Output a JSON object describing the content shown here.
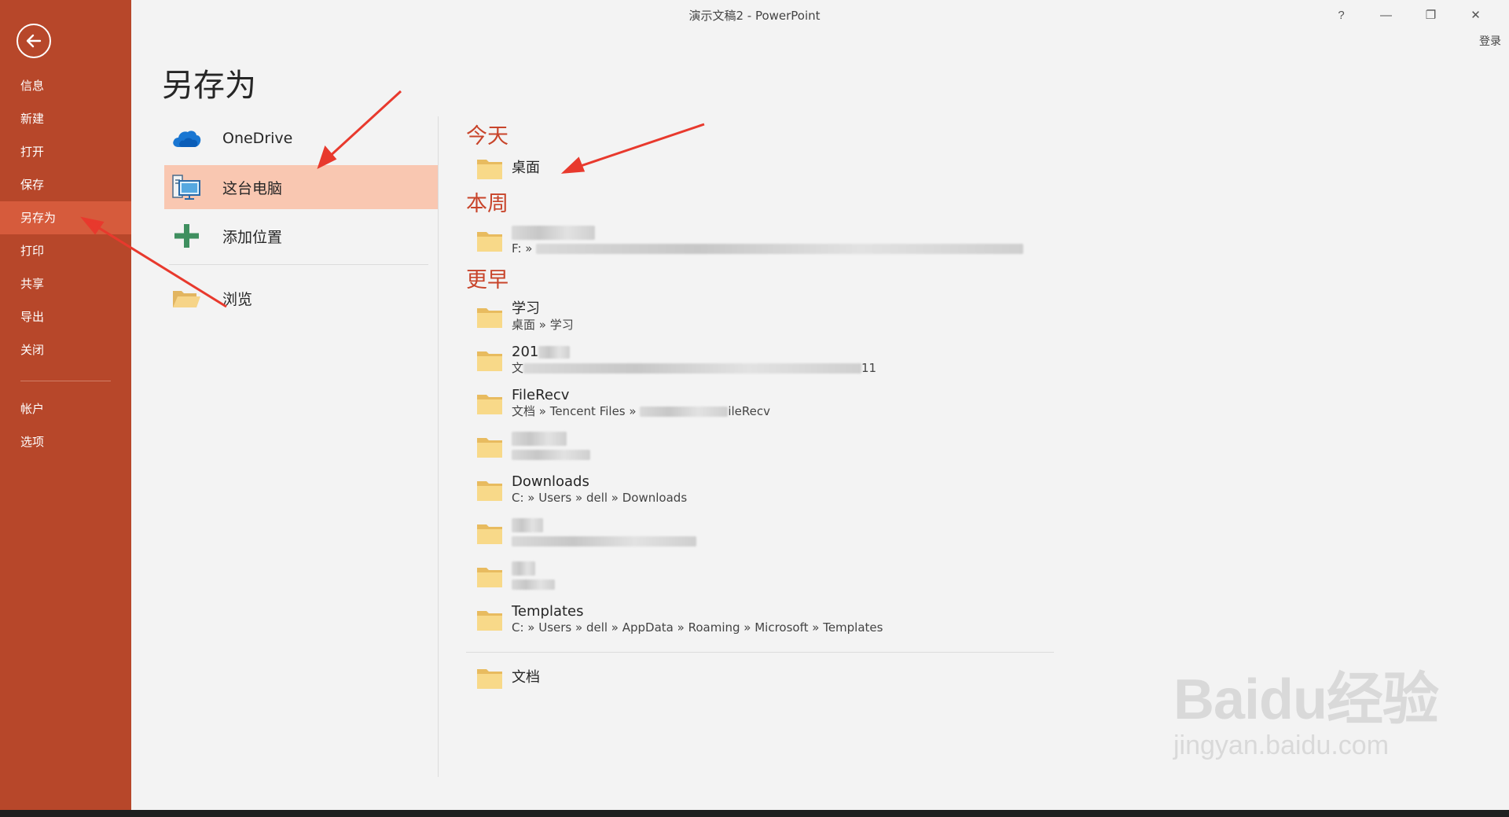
{
  "window": {
    "title": "演示文稿2 - PowerPoint",
    "help": "?",
    "minimize": "—",
    "restore": "❐",
    "close": "✕",
    "signin": "登录"
  },
  "sidebar": {
    "items": [
      {
        "label": "信息"
      },
      {
        "label": "新建"
      },
      {
        "label": "打开"
      },
      {
        "label": "保存"
      },
      {
        "label": "另存为",
        "active": true
      },
      {
        "label": "打印"
      },
      {
        "label": "共享"
      },
      {
        "label": "导出"
      },
      {
        "label": "关闭"
      }
    ],
    "bottom_items": [
      {
        "label": "帐户"
      },
      {
        "label": "选项"
      }
    ]
  },
  "page": {
    "title": "另存为"
  },
  "locations": {
    "onedrive": "OneDrive",
    "this_pc": "这台电脑",
    "add_place": "添加位置",
    "browse": "浏览"
  },
  "recent": {
    "today_head": "今天",
    "this_week_head": "本周",
    "older_head": "更早",
    "today": [
      {
        "name": "桌面"
      }
    ],
    "week": [
      {
        "name_prefix": "",
        "path_prefix": "F: » "
      }
    ],
    "older": [
      {
        "name": "学习",
        "path": "桌面 » 学习"
      },
      {
        "name": "201",
        "path_prefix": "文",
        "path_suffix": "11"
      },
      {
        "name": "FileRecv",
        "path_prefix": "文档 » Tencent Files » ",
        "path_suffix": "ileRecv"
      },
      {
        "name": "",
        "path": ""
      },
      {
        "name": "Downloads",
        "path": "C: » Users » dell » Downloads"
      },
      {
        "name": "",
        "path": ""
      },
      {
        "name": "",
        "path": ""
      },
      {
        "name": "Templates",
        "path": "C: » Users » dell » AppData » Roaming » Microsoft » Templates"
      }
    ],
    "documents": "文档"
  },
  "watermark": {
    "logo": "Baidu经验",
    "url": "jingyan.baidu.com"
  },
  "colors": {
    "sidebar": "#b7472a",
    "sidebar_active": "#d65b3c",
    "location_active": "#f9c7b1",
    "group_heading": "#c8442a",
    "arrow": "#e8392d"
  }
}
